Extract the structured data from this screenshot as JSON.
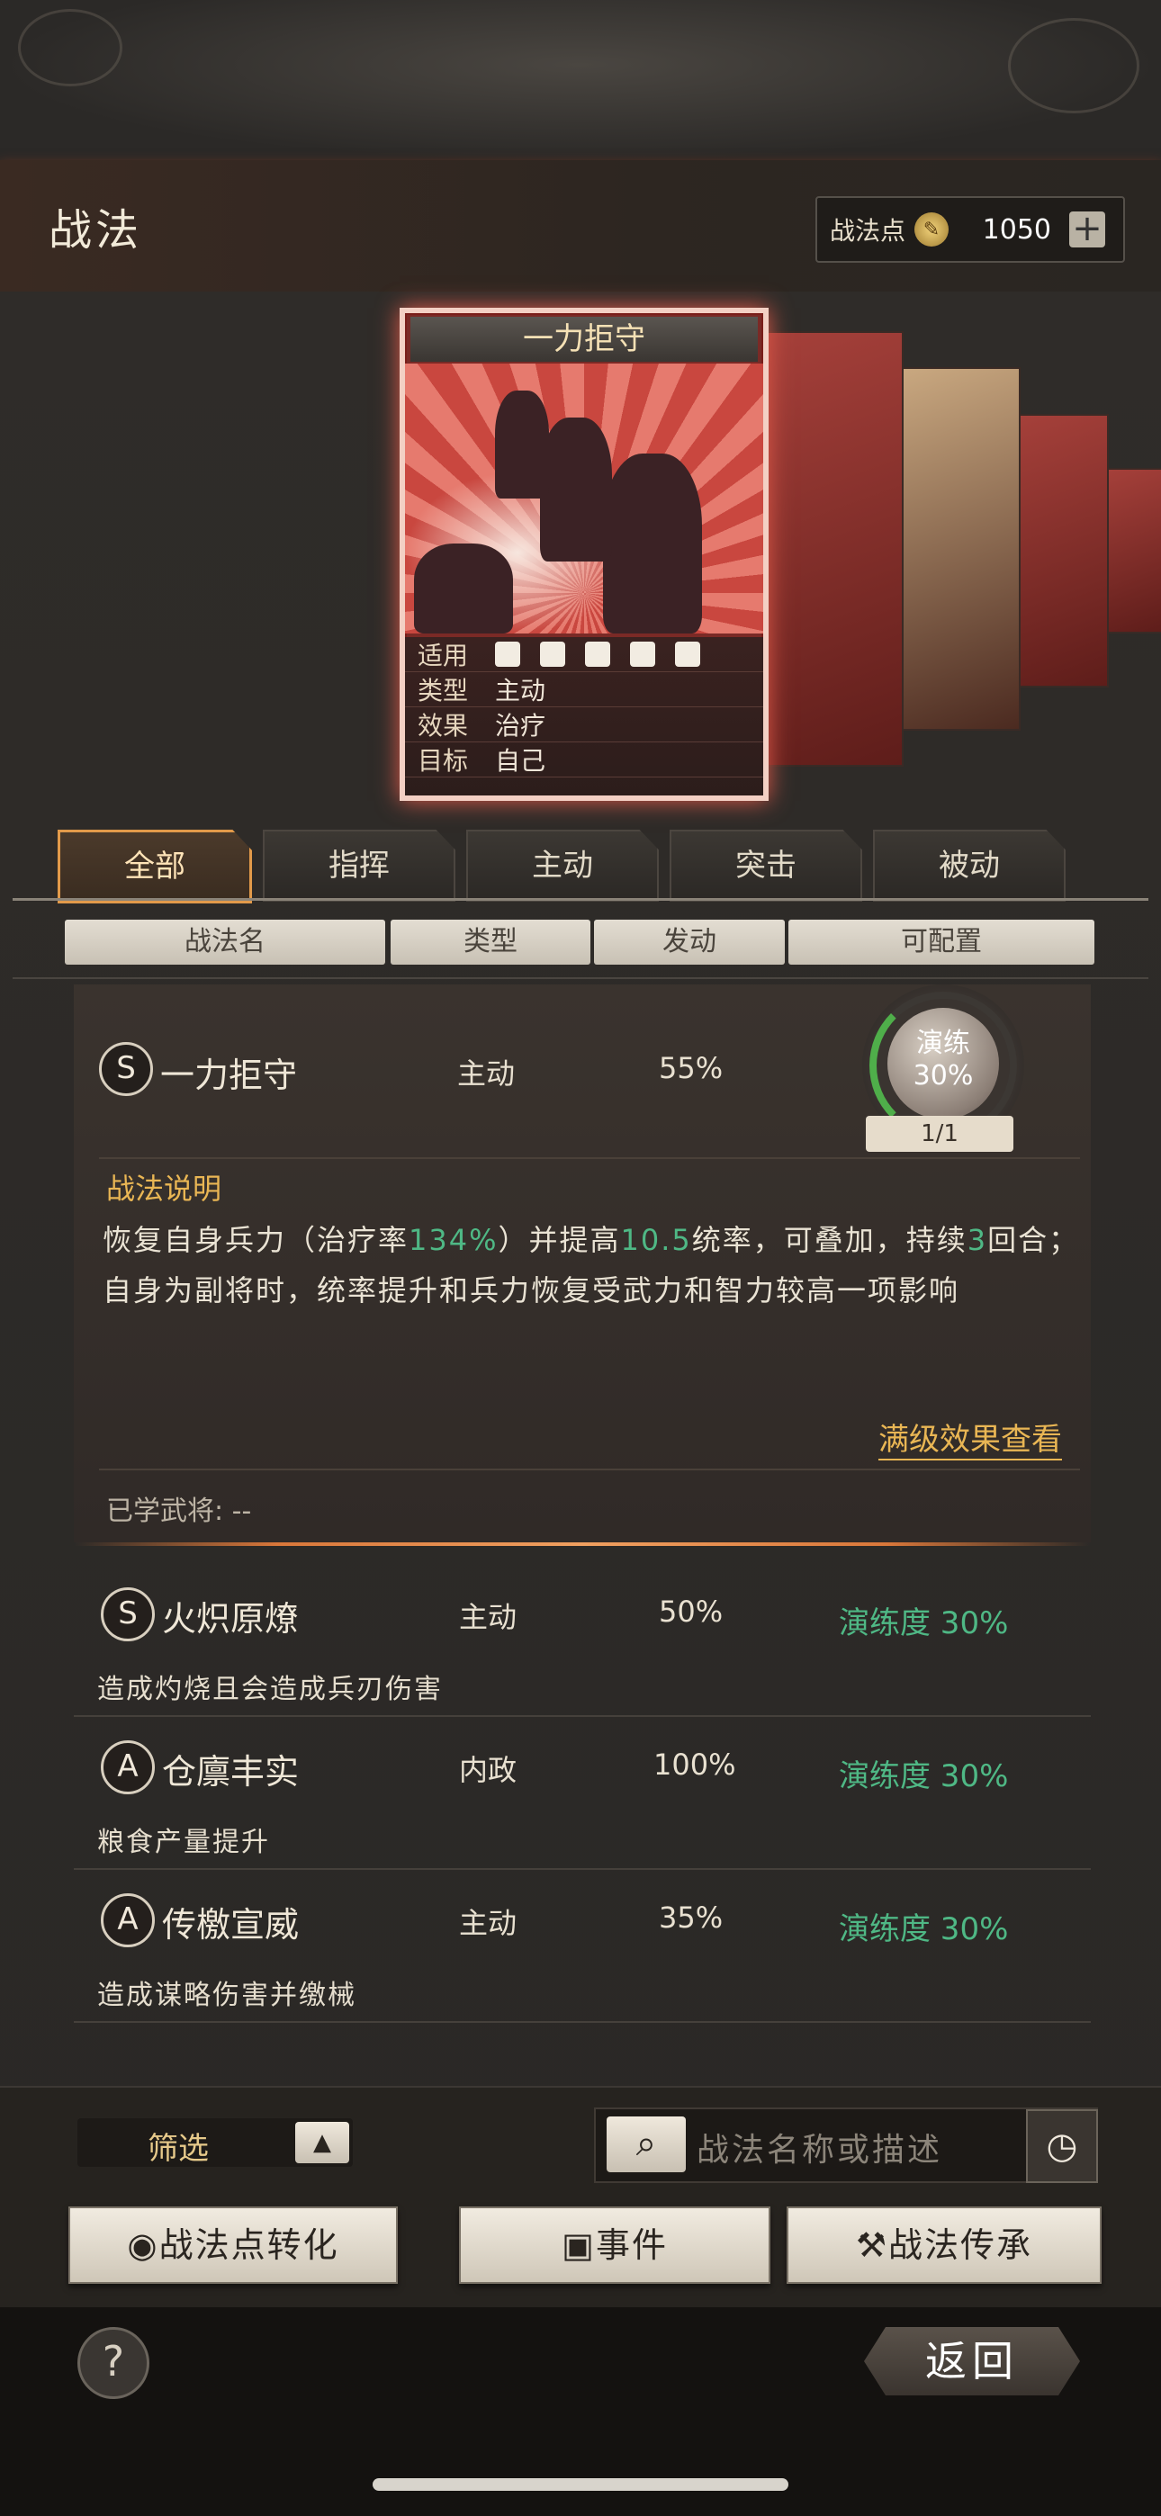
{
  "header": {
    "title": "战法",
    "points_label": "战法点",
    "points_value": "1050",
    "plus_label": "+"
  },
  "card": {
    "name": "一力拒守",
    "rows": [
      {
        "key": "适用",
        "value": ""
      },
      {
        "key": "类型",
        "value": "主动"
      },
      {
        "key": "效果",
        "value": "治疗"
      },
      {
        "key": "目标",
        "value": "自己"
      }
    ],
    "applicable_icons": [
      "cavalry-icon",
      "shield-icon",
      "bow-icon",
      "spear-icon",
      "wheel-icon"
    ]
  },
  "tabs": [
    "全部",
    "指挥",
    "主动",
    "突击",
    "被动"
  ],
  "columns": [
    "战法名",
    "类型",
    "发动",
    "可配置"
  ],
  "expanded": {
    "grade": "S",
    "name": "一力拒守",
    "type": "主动",
    "rate": "55%",
    "train_label": "演练",
    "train_value": "30%",
    "level": "1/1",
    "desc_title": "战法说明",
    "desc_parts": [
      "恢复自身兵力（治疗率",
      "134%",
      "）并提高",
      "10.5",
      "统率，可叠加，持续",
      "3",
      "回合；自身为副将时，统率提升和兵力恢复受武力和智力较高一项影响"
    ],
    "full_effect": "满级效果查看",
    "learned": "已学武将: --"
  },
  "items": [
    {
      "grade": "S",
      "name": "火炽原燎",
      "type": "主动",
      "rate": "50%",
      "train": "演练度 30%",
      "sub": "造成灼烧且会造成兵刃伤害"
    },
    {
      "grade": "A",
      "name": "仓廪丰实",
      "type": "内政",
      "rate": "100%",
      "train": "演练度 30%",
      "sub": "粮食产量提升"
    },
    {
      "grade": "A",
      "name": "传檄宣威",
      "type": "主动",
      "rate": "35%",
      "train": "演练度 30%",
      "sub": "造成谋略伤害并缴械"
    }
  ],
  "bottom": {
    "filter_label": "筛选",
    "search_placeholder": "战法名称或描述",
    "btn_convert": "战法点转化",
    "btn_event": "事件",
    "btn_inherit": "战法传承",
    "help": "?",
    "back": "返回"
  },
  "colors": {
    "accent_orange": "#e29a4a",
    "green": "#4fb885",
    "gold": "#e9b654"
  }
}
